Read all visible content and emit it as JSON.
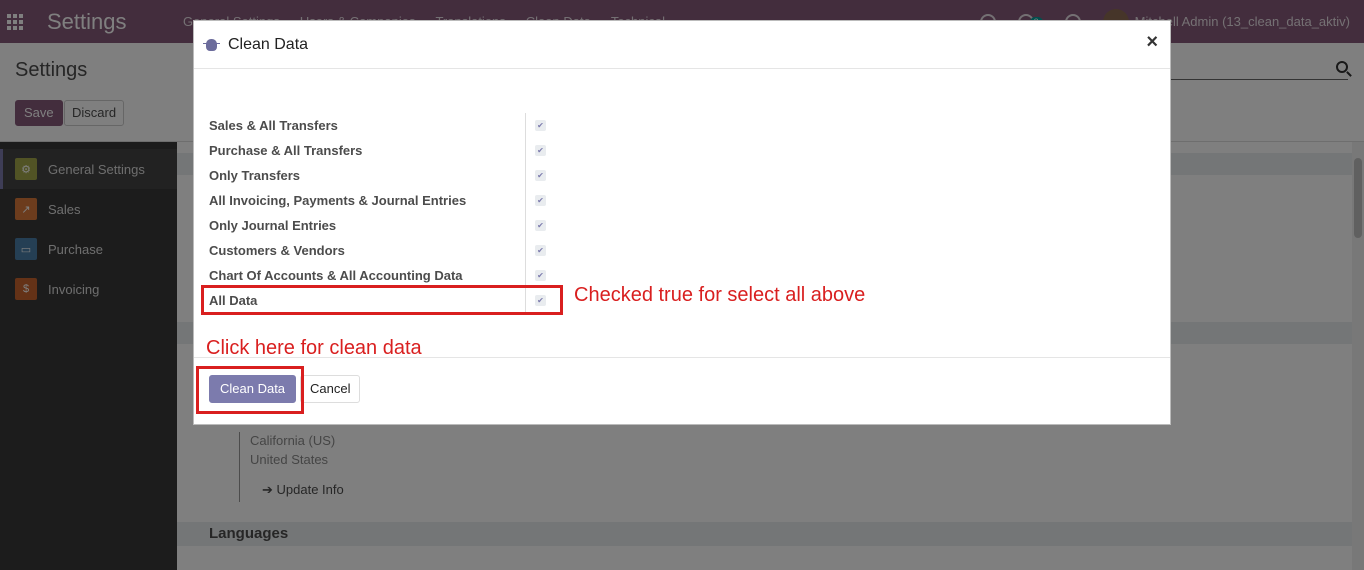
{
  "navbar": {
    "brand": "Settings",
    "menu": [
      "General Settings",
      "Users & Companies",
      "Translations",
      "Clean Data",
      "Technical"
    ],
    "messages_badge": "2",
    "user": "Mitchell Admin (13_clean_data_aktiv)"
  },
  "control_panel": {
    "breadcrumb": "Settings",
    "save_label": "Save",
    "discard_label": "Discard"
  },
  "sidebar": {
    "items": [
      {
        "label": "General Settings",
        "icon": "gear-icon",
        "color": "#a2a74a"
      },
      {
        "label": "Sales",
        "icon": "chart-icon",
        "color": "#d8793a"
      },
      {
        "label": "Purchase",
        "icon": "card-icon",
        "color": "#4a7fa8"
      },
      {
        "label": "Invoicing",
        "icon": "dollar-doc-icon",
        "color": "#c8652f"
      }
    ]
  },
  "background_content": {
    "address_line_1": "California (US)",
    "address_line_2": "United States",
    "update_info": "Update Info",
    "languages_title": "Languages"
  },
  "modal": {
    "title": "Clean Data",
    "close_label": "×",
    "fields": [
      {
        "label": "Sales & All Transfers",
        "checked": true
      },
      {
        "label": "Purchase & All Transfers",
        "checked": true
      },
      {
        "label": "Only Transfers",
        "checked": true
      },
      {
        "label": "All Invoicing, Payments & Journal Entries",
        "checked": true
      },
      {
        "label": "Only Journal Entries",
        "checked": true
      },
      {
        "label": "Customers & Vendors",
        "checked": true
      },
      {
        "label": "Chart Of Accounts & All Accounting Data",
        "checked": true
      },
      {
        "label": "All Data",
        "checked": true
      }
    ],
    "clean_button": "Clean Data",
    "cancel_button": "Cancel"
  },
  "annotations": {
    "select_all_note": "Checked true for select all above",
    "clean_note": "Click here for clean data",
    "color": "#d91f1f"
  }
}
